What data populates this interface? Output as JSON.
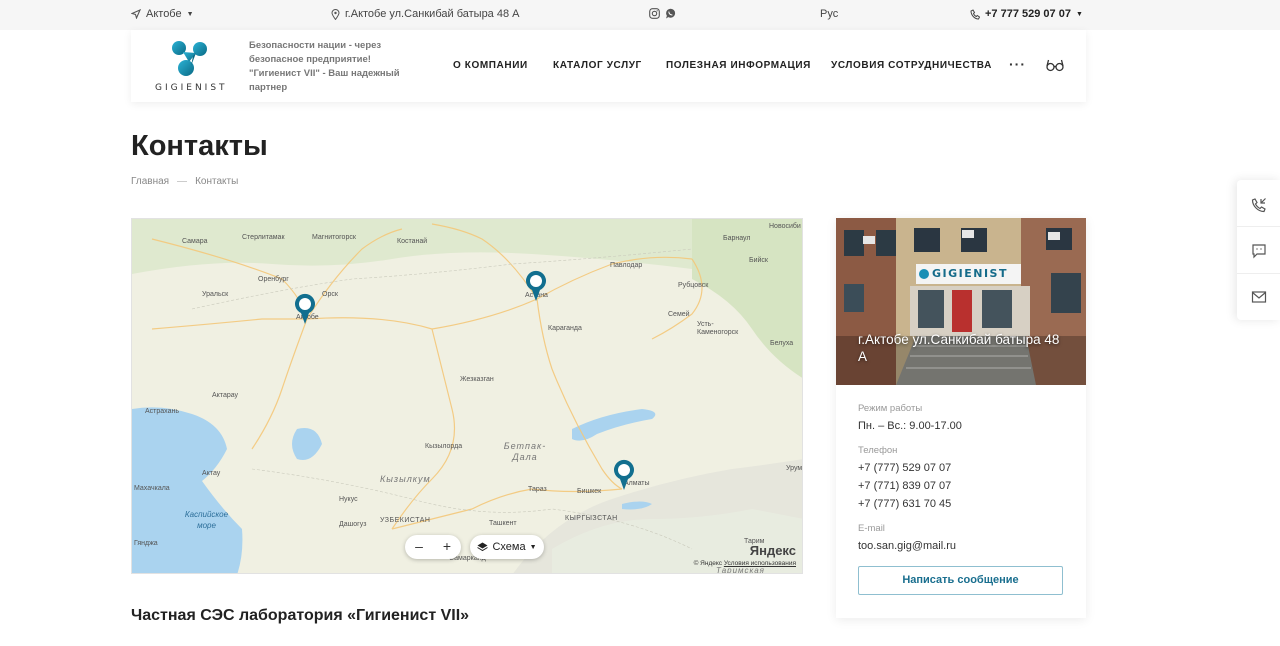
{
  "topbar": {
    "city": "Актобе",
    "address": "г.Актобе ул.Санкибай батыра 48 А",
    "language": "Рус",
    "phone": "+7 777 529 07 07",
    "social": [
      "instagram-icon",
      "whatsapp-icon"
    ]
  },
  "header": {
    "logo_text": "GIGIENIST",
    "slogan": "Безопасности нации - через безопасное предприятие! \"Гигиенист VII\" - Ваш надежный партнер",
    "nav": [
      "О КОМПАНИИ",
      "КАТАЛОГ УСЛУГ",
      "ПОЛЕЗНАЯ ИНФОРМАЦИЯ",
      "УСЛОВИЯ СОТРУДНИЧЕСТВА"
    ],
    "more": "···"
  },
  "page": {
    "title": "Контакты",
    "breadcrumb": [
      "Главная",
      "Контакты"
    ]
  },
  "map": {
    "labels": {
      "samara": "Самара",
      "sterlitamak": "Стерлитамак",
      "magnitogorsk": "Магнитогорск",
      "kostanay": "Костанай",
      "novosibirsk": "Новосиби",
      "barnaul": "Барнаул",
      "orenburg": "Оренбург",
      "orsk": "Орск",
      "uralsk": "Уральск",
      "aktobe": "Актобе",
      "astana": "Астана",
      "pavlodar": "Павлодар",
      "biysk": "Бийск",
      "rubtsovsk": "Рубцовск",
      "semey": "Семей",
      "ustkam": "Усть-Каменогорск",
      "karaganda": "Караганда",
      "zhezkazgan": "Жезказган",
      "aktau_ru": "Актарау",
      "atyrau": "Атырау",
      "astrakhan": "Астрахань",
      "kyzylorda": "Кызылорда",
      "betpak": "Бетпак-Дала",
      "kyzylkum": "Кызылкум",
      "aktau": "Актау",
      "makhachkala": "Махачкала",
      "nukus": "Нукус",
      "dashoguz": "Дашогуз",
      "taraz": "Тараз",
      "bishkek": "Бишкек",
      "almaty": "Алматы",
      "kyrgyzstan": "КЫРГЫЗСТАН",
      "uzbekistan": "УЗБЕКИСТАН",
      "tashkent": "Ташкент",
      "samarkand": "Самарканд",
      "ganja": "Гянджа",
      "caspian": "Каспийское море",
      "urumqi": "Урум",
      "belukha": "Белуха",
      "tarim": "Таримская",
      "tarim_r": "Тарим"
    },
    "zoom_minus": "–",
    "zoom_plus": "+",
    "scheme_label": "Схема",
    "brand": "Яндекс",
    "copyright": "© Яндекс",
    "terms": "Условия использования"
  },
  "contact": {
    "photo_caption": "г.Актобе ул.Санкибай батыра 48 А",
    "sign_text": "GIGIENIST",
    "hours_label": "Режим работы",
    "hours": "Пн. – Вс.: 9.00-17.00",
    "phone_label": "Телефон",
    "phones": [
      "+7 (777) 529 07 07",
      "+7 (771) 839 07 07",
      "+7 (777) 631 70 45"
    ],
    "email_label": "E-mail",
    "email": "too.san.gig@mail.ru",
    "button": "Написать сообщение"
  },
  "section_title": "Частная СЭС лаборатория «Гигиенист VII»",
  "colors": {
    "accent": "#1a6f8f",
    "pin": "#126f8f",
    "water": "#aad3ef"
  }
}
